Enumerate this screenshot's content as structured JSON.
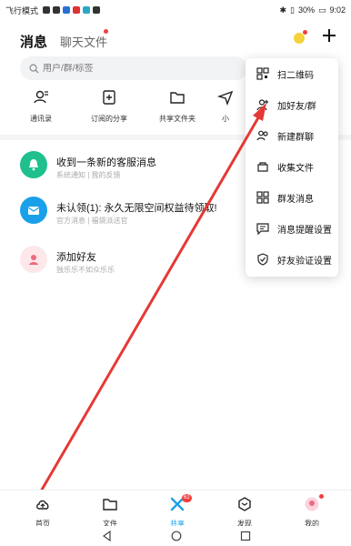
{
  "status_bar": {
    "left_text": "飞行模式",
    "battery": "30%",
    "time": "9:02"
  },
  "header": {
    "tab_messages": "消息",
    "tab_files": "聊天文件"
  },
  "search": {
    "placeholder": "用户/群/标签"
  },
  "quick_actions": [
    {
      "label": "通讯录",
      "icon": "contacts-icon"
    },
    {
      "label": "订阅的分享",
      "icon": "subscription-icon"
    },
    {
      "label": "共享文件夹",
      "icon": "folder-icon"
    },
    {
      "label": "小",
      "icon": "send-icon"
    }
  ],
  "messages": [
    {
      "title": "收到一条新的客服消息",
      "sub1": "系统通知",
      "sub2": "我的反馈",
      "icon": "bell-icon",
      "color": "#1fc08e"
    },
    {
      "title": "未认领(1): 永久无限空间权益待领取!",
      "sub1": "官方消息",
      "sub2": "福袋派送官",
      "icon": "mail-icon",
      "color": "#1aa0e8"
    },
    {
      "title": "添加好友",
      "sub1": "独乐乐不如众乐乐",
      "sub2": "",
      "icon": "add-friend-icon",
      "color": "#fde7ea"
    }
  ],
  "menu": {
    "items": [
      {
        "label": "扫二维码",
        "icon": "qr-code-icon"
      },
      {
        "label": "加好友/群",
        "icon": "add-user-icon"
      },
      {
        "label": "新建群聊",
        "icon": "new-group-icon"
      },
      {
        "label": "收集文件",
        "icon": "collect-file-icon"
      },
      {
        "label": "群发消息",
        "icon": "broadcast-icon"
      },
      {
        "label": "消息提醒设置",
        "icon": "notification-settings-icon"
      },
      {
        "label": "好友验证设置",
        "icon": "verify-settings-icon"
      }
    ]
  },
  "bottom_nav": {
    "items": [
      {
        "label": "首页",
        "icon": "home-cloud-icon"
      },
      {
        "label": "文件",
        "icon": "file-icon"
      },
      {
        "label": "共享",
        "icon": "share-icon",
        "badge": "62"
      },
      {
        "label": "发现",
        "icon": "discover-icon"
      },
      {
        "label": "我的",
        "icon": "profile-icon"
      }
    ]
  },
  "colors": {
    "accent": "#1aa0e8",
    "red_arrow": "#e53935"
  }
}
